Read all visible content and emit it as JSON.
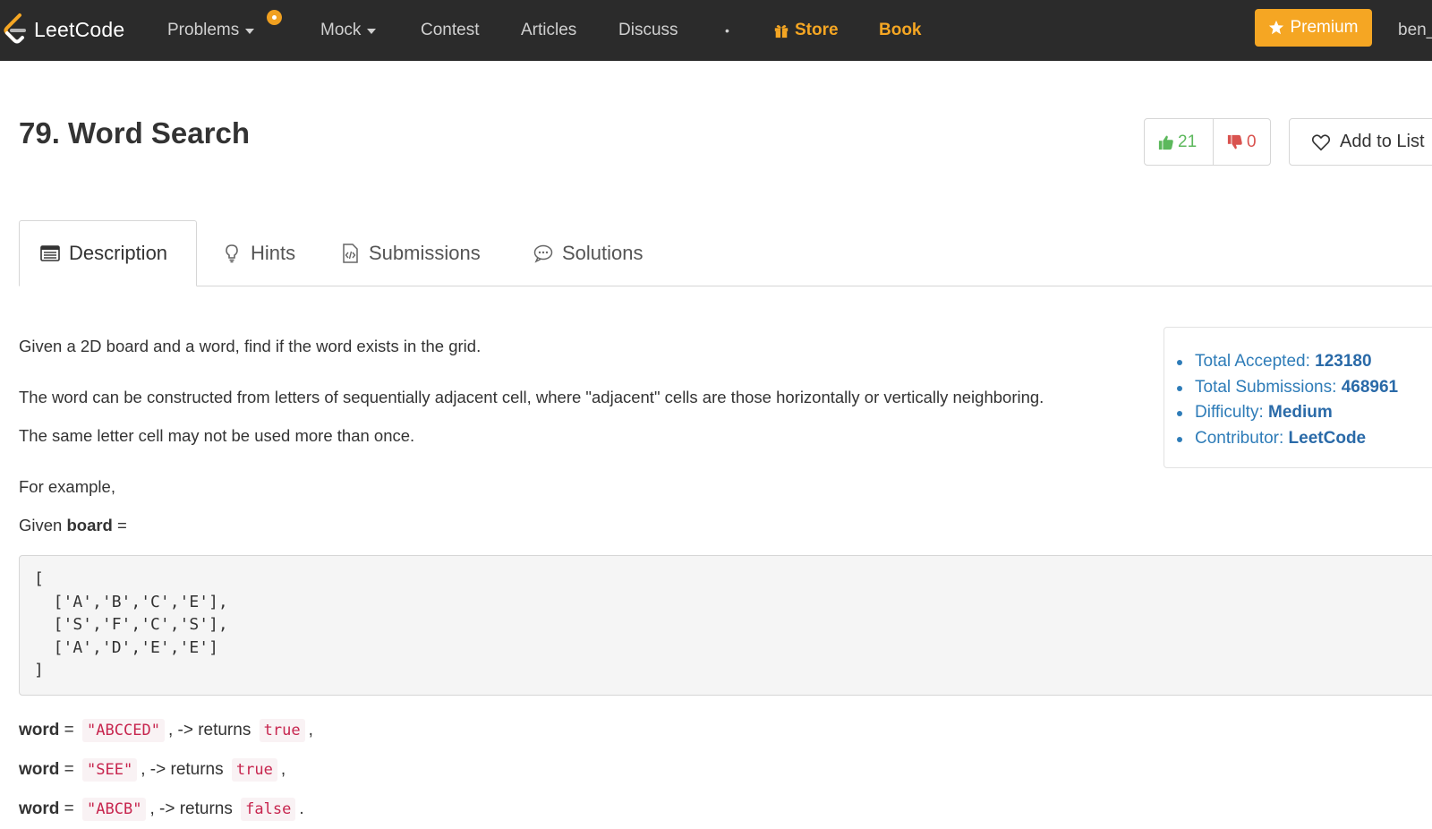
{
  "nav": {
    "brand": "LeetCode",
    "items": [
      "Problems",
      "Mock",
      "Contest",
      "Articles",
      "Discuss"
    ],
    "separator": "•",
    "store": "Store",
    "book": "Book",
    "premium": "Premium",
    "user": "ben_"
  },
  "problem": {
    "title": "79. Word Search",
    "upvotes": "21",
    "downvotes": "0",
    "add_to_list": "Add to List"
  },
  "tabs": [
    "Description",
    "Hints",
    "Submissions",
    "Solutions"
  ],
  "description": {
    "p1": "Given a 2D board and a word, find if the word exists in the grid.",
    "p2": "The word can be constructed from letters of sequentially adjacent cell, where \"adjacent\" cells are those horizontally or vertically neighboring.",
    "p3": "The same letter cell may not be used more than once.",
    "p4": "For example,",
    "p5_prefix": "Given ",
    "p5_bold": "board",
    "p5_suffix": " =",
    "board_code": "[\n  ['A','B','C','E'],\n  ['S','F','C','S'],\n  ['A','D','E','E']\n]",
    "examples": [
      {
        "label": "word",
        "eq": " = ",
        "value": "\"ABCCED\"",
        "mid": ", -> returns ",
        "result": "true",
        "end": ","
      },
      {
        "label": "word",
        "eq": " = ",
        "value": "\"SEE\"",
        "mid": ", -> returns ",
        "result": "true",
        "end": ","
      },
      {
        "label": "word",
        "eq": " = ",
        "value": "\"ABCB\"",
        "mid": ", -> returns ",
        "result": "false",
        "end": "."
      }
    ]
  },
  "stats": {
    "accepted_label": "Total Accepted: ",
    "accepted_value": "123180",
    "submissions_label": "Total Submissions: ",
    "submissions_value": "468961",
    "difficulty_label": "Difficulty: ",
    "difficulty_value": "Medium",
    "contributor_label": "Contributor: ",
    "contributor_value": "LeetCode"
  },
  "colors": {
    "nav_bg": "#2b2b2b",
    "accent_orange": "#f5a623",
    "link_blue": "#2e7cb8",
    "code_red": "#c7254e"
  }
}
